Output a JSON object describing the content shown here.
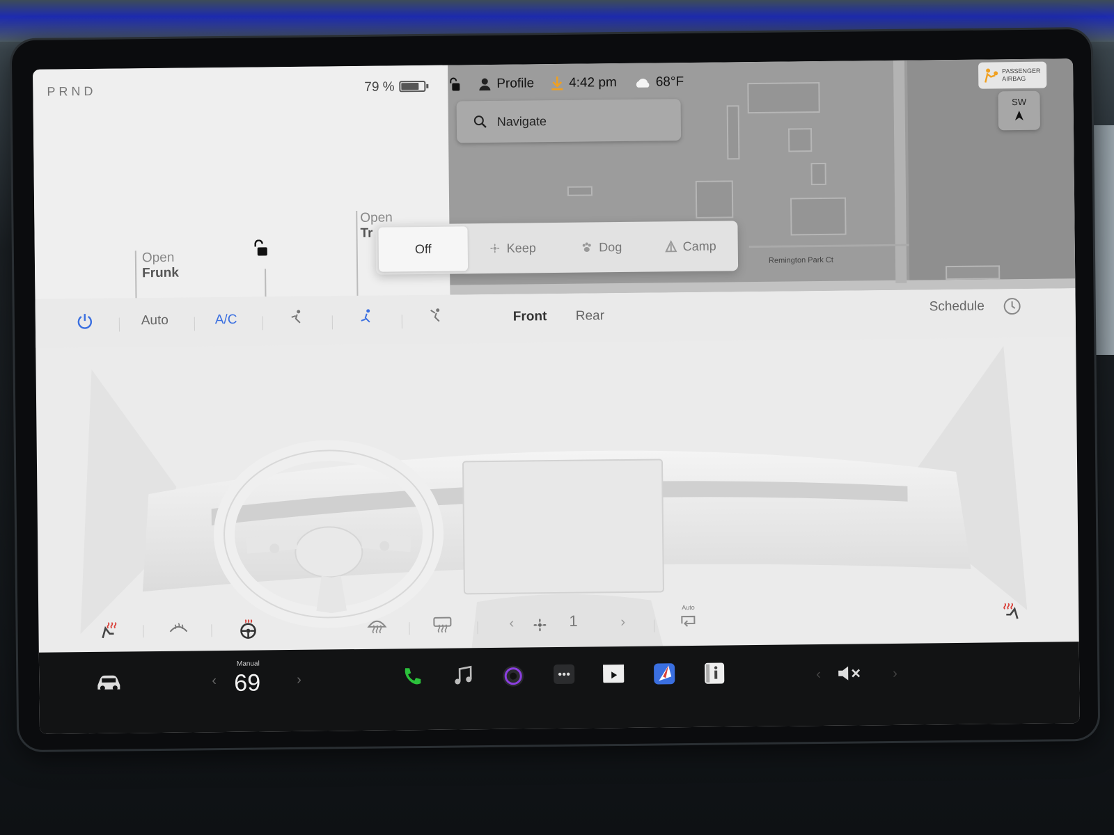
{
  "car": {
    "gear": "PRND",
    "battery_percent": "79 %",
    "battery_level": 0.79,
    "frunk": {
      "action": "Open",
      "name": "Frunk"
    },
    "trunk": {
      "action": "Open",
      "name": "Tr"
    }
  },
  "status": {
    "profile": "Profile",
    "time": "4:42 pm",
    "temperature": "68°F"
  },
  "map": {
    "search_placeholder": "Navigate",
    "street_label": "Remington Park Ct",
    "airbag_label_1": "PASSENGER",
    "airbag_label_2": "AIRBAG",
    "compass_heading": "SW"
  },
  "climate_modes": {
    "options": [
      "Off",
      "Keep",
      "Dog",
      "Camp"
    ],
    "selected": "Off"
  },
  "climate_bar": {
    "auto": "Auto",
    "ac": "A/C",
    "front": "Front",
    "rear": "Rear",
    "schedule": "Schedule"
  },
  "controls": {
    "fan_speed": "1",
    "recirc_label": "Auto"
  },
  "dock": {
    "temp_mode": "Manual",
    "temperature": "69"
  },
  "colors": {
    "accent_blue": "#3a6fe0",
    "heat_red": "#d9413a",
    "phone_green": "#2bc13b"
  },
  "icons": [
    "power-icon",
    "vent-face-icon",
    "vent-feet-icon",
    "vent-defrost-icon",
    "clock-icon",
    "seat-heat-left-icon",
    "wiper-heat-icon",
    "steering-wheel-heat-icon",
    "defrost-front-icon",
    "defrost-rear-icon",
    "fan-icon",
    "recirculate-icon",
    "seat-heat-right-icon",
    "car-icon",
    "phone-icon",
    "music-icon",
    "camera-icon",
    "more-icon",
    "theater-icon",
    "navigation-app-icon",
    "manual-icon",
    "volume-mute-icon"
  ]
}
